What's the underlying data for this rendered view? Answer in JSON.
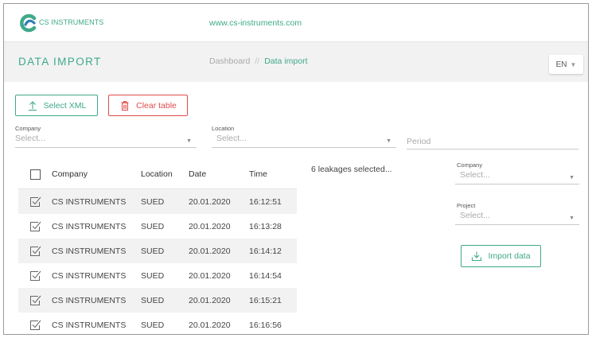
{
  "brand": {
    "logo_text": "CS INSTRUMENTS",
    "url": "www.cs-instruments.com",
    "accent_color": "#3fa98a",
    "danger_color": "#e14b4b"
  },
  "header": {
    "title": "DATA IMPORT",
    "breadcrumb": {
      "parent": "Dashboard",
      "separator": "//",
      "current": "Data import"
    },
    "language": "EN"
  },
  "toolbar": {
    "select_xml_label": "Select XML",
    "clear_table_label": "Clear table"
  },
  "filters": {
    "company": {
      "label": "Company",
      "placeholder": "Select..."
    },
    "location": {
      "label": "Location",
      "placeholder": "Select..."
    },
    "period": {
      "placeholder": "Period"
    }
  },
  "table": {
    "columns": [
      "Company",
      "Location",
      "Date",
      "Time"
    ],
    "rows": [
      {
        "company": "CS INSTRUMENTS",
        "location": "SUED",
        "date": "20.01.2020",
        "time": "16:12:51",
        "checked": true
      },
      {
        "company": "CS INSTRUMENTS",
        "location": "SUED",
        "date": "20.01.2020",
        "time": "16:13:28",
        "checked": true
      },
      {
        "company": "CS INSTRUMENTS",
        "location": "SUED",
        "date": "20.01.2020",
        "time": "16:14:12",
        "checked": true
      },
      {
        "company": "CS INSTRUMENTS",
        "location": "SUED",
        "date": "20.01.2020",
        "time": "16:14:54",
        "checked": true
      },
      {
        "company": "CS INSTRUMENTS",
        "location": "SUED",
        "date": "20.01.2020",
        "time": "16:15:21",
        "checked": true
      },
      {
        "company": "CS INSTRUMENTS",
        "location": "SUED",
        "date": "20.01.2020",
        "time": "16:16:56",
        "checked": true
      }
    ]
  },
  "selection": {
    "summary": "6 leakages selected..."
  },
  "import_panel": {
    "company": {
      "label": "Company",
      "placeholder": "Select..."
    },
    "project": {
      "label": "Project",
      "placeholder": "Select..."
    },
    "import_label": "Import data"
  }
}
